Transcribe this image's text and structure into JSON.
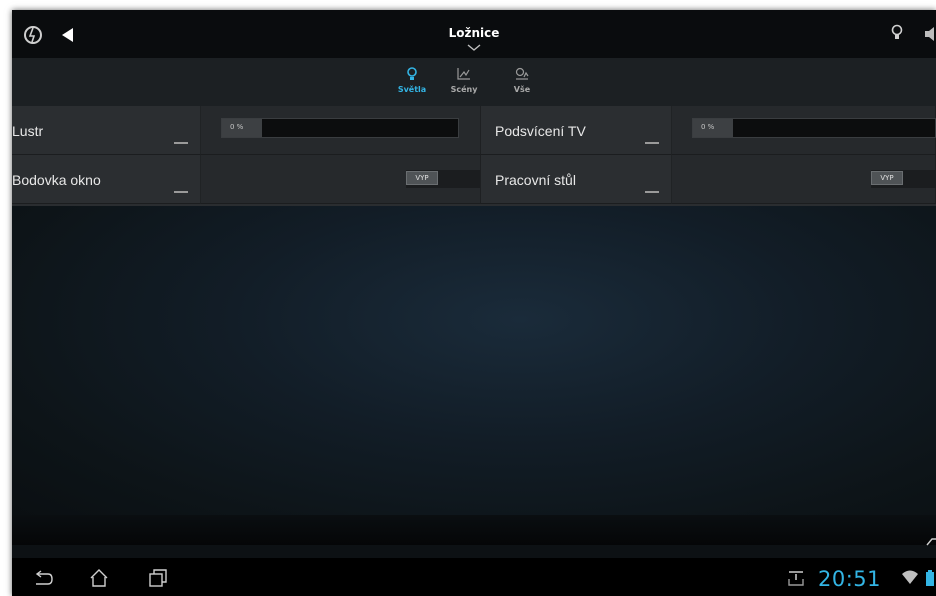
{
  "actionbar": {
    "title": "Ložnice",
    "icons": [
      "app-logo-icon",
      "back-arrow-icon",
      "chevron-down-icon",
      "bulb-icon",
      "speaker-icon"
    ]
  },
  "tabs": [
    {
      "label": "Světla",
      "icon": "bulb-icon",
      "active": true
    },
    {
      "label": "Scény",
      "icon": "scene-icon",
      "active": false
    },
    {
      "label": "Vše",
      "icon": "all-icon",
      "active": false
    }
  ],
  "devices": [
    {
      "name": "Lustr",
      "control": "dimmer",
      "value": "0 %",
      "level": 0.1
    },
    {
      "name": "Podsvícení TV",
      "control": "dimmer",
      "value": "0 %",
      "level": 0.1
    },
    {
      "name": "Bodovka okno",
      "control": "switch",
      "state": "VYP"
    },
    {
      "name": "Pracovní stůl",
      "control": "switch",
      "state": "VYP"
    }
  ],
  "navbar": {
    "clock": "20:51",
    "icons": [
      "back-icon",
      "home-icon",
      "recent-apps-icon",
      "download-notification-icon",
      "wifi-icon",
      "battery-icon"
    ]
  },
  "colors": {
    "accent": "#33b5e5",
    "actionbar": "#0a0c0e",
    "tabbar": "#1c2023",
    "cell": "#2b2e31",
    "navbar": "#000000"
  }
}
